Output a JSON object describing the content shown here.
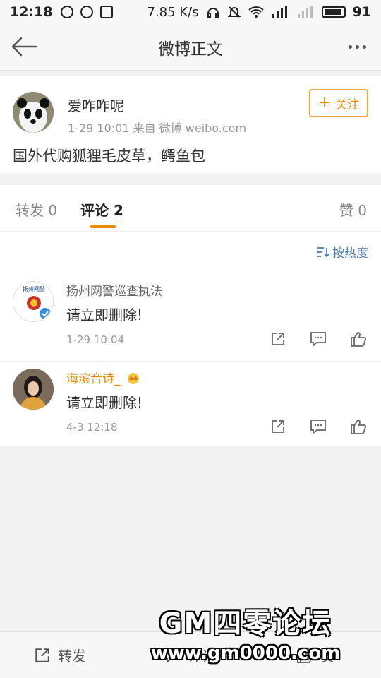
{
  "status_bar": {
    "time": "12:18",
    "speed": "7.85 K/s",
    "battery": "91"
  },
  "navbar": {
    "title": "微博正文"
  },
  "post": {
    "author": "爱咋咋呢",
    "meta": "1-29 10:01  来自 微博 weibo.com",
    "follow_label": "关注",
    "content": "国外代购狐狸毛皮草，鳄鱼包"
  },
  "tabs": {
    "repost": "转发 0",
    "comments": "评论 2",
    "likes": "赞 0"
  },
  "comments_header": {
    "sort_label": "按热度"
  },
  "comments": [
    {
      "name": "扬州网警巡查执法",
      "text": "请立即删除!",
      "time": "1-29 10:04",
      "avatar_text": "扬州网警"
    },
    {
      "name": "海滨音诗_",
      "text": "请立即删除!",
      "time": "4-3 12:18"
    }
  ],
  "bottom_bar": {
    "repost": "转发",
    "comment": "评论",
    "like": "赞"
  },
  "watermark": {
    "line1": "GM四零论坛",
    "line2": "www.gm0000.com"
  },
  "colors": {
    "accent": "#f08a00",
    "link": "#4b7ab5"
  }
}
